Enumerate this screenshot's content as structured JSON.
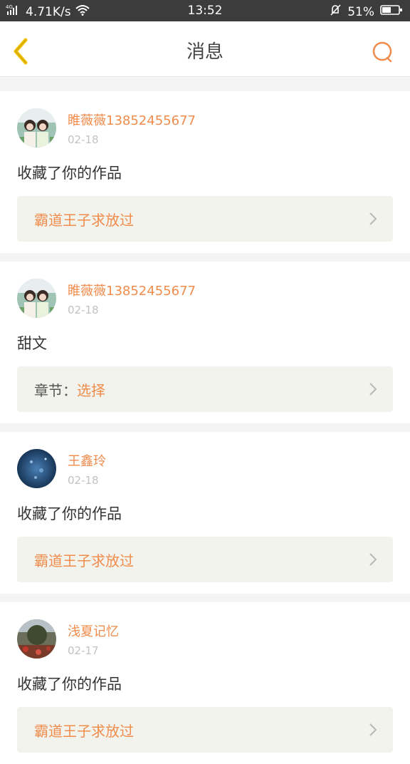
{
  "status_bar": {
    "network": "4G",
    "speed": "4.71K/s",
    "time": "13:52",
    "battery": "51%"
  },
  "header": {
    "title": "消息"
  },
  "messages": [
    {
      "user": "睢薇薇13852455677",
      "date": "02-18",
      "text": "收藏了你的作品",
      "work_title": "霸道王子求放过",
      "avatar": "avatar-girls-photo"
    },
    {
      "user": "睢薇薇13852455677",
      "date": "02-18",
      "text": "甜文",
      "chapter_label": "章节：",
      "chapter_value": "选择",
      "avatar": "avatar-girls-photo"
    },
    {
      "user": "王鑫玲",
      "date": "02-18",
      "text": "收藏了你的作品",
      "work_title": "霸道王子求放过",
      "avatar": "avatar-blue-night-photo"
    },
    {
      "user": "浅夏记忆",
      "date": "02-17",
      "text": "收藏了你的作品",
      "work_title": "霸道王子求放过",
      "avatar": "avatar-garden-photo"
    }
  ],
  "colors": {
    "accent": "#f08c4c",
    "back_arrow": "#f2c200",
    "statusbar": "#3c3c3c"
  }
}
